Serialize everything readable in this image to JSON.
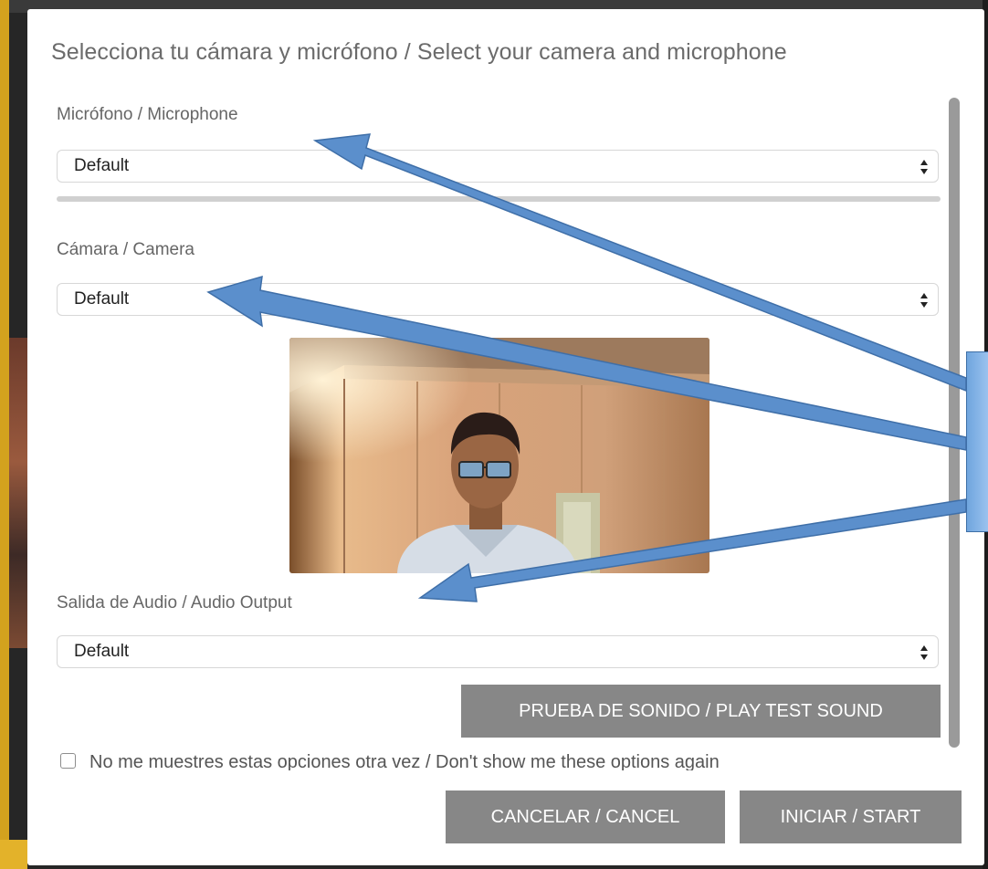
{
  "dialog": {
    "title": "Selecciona tu cámara y micrófono / Select your camera and microphone",
    "microphone": {
      "label": "Micrófono / Microphone",
      "value": "Default"
    },
    "camera": {
      "label": "Cámara / Camera",
      "value": "Default"
    },
    "audio_output": {
      "label": "Salida de Audio / Audio Output",
      "value": "Default"
    },
    "test_sound_button": "PRUEBA DE SONIDO / PLAY TEST SOUND",
    "dont_show_checkbox": {
      "label": "No me muestres estas opciones otra vez / Don't show me these options again",
      "checked": false
    },
    "cancel_button": "CANCELAR / CANCEL",
    "start_button": "INICIAR / START"
  },
  "annotation": {
    "arrow_color": "#5b8fcc",
    "targets": [
      "microphone-label",
      "camera-select",
      "audio-output-label"
    ]
  },
  "colors": {
    "button_bg": "#878787",
    "scroll_thumb": "#9a9a9a",
    "label_text": "#666666"
  }
}
